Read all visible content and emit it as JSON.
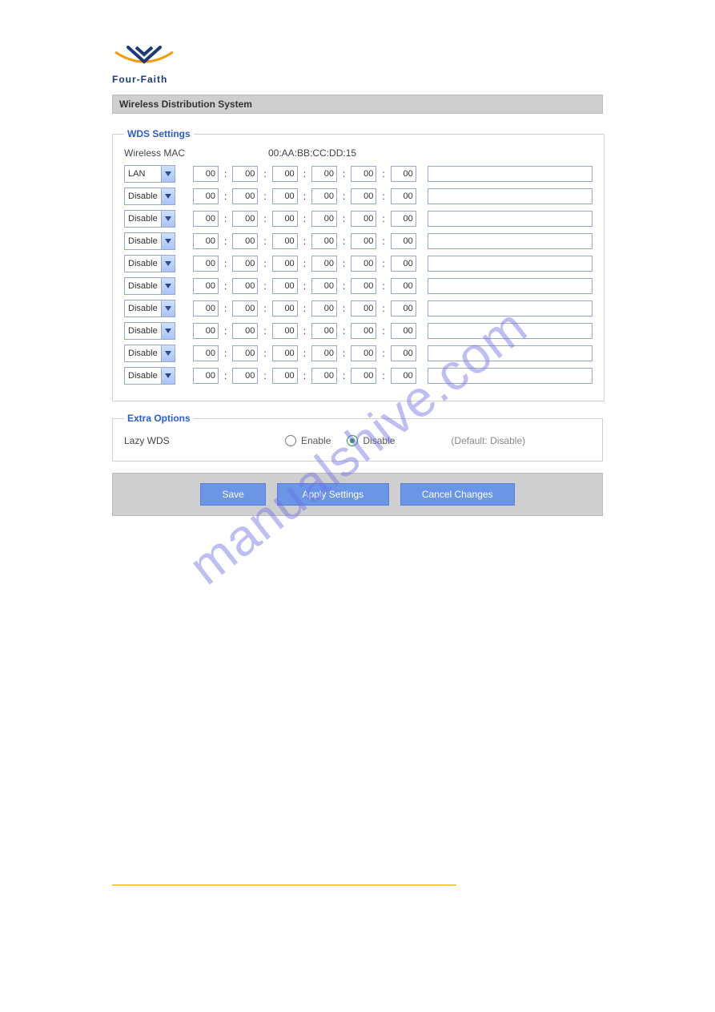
{
  "brand": "Four-Faith",
  "page_title": "Wireless Distribution System",
  "watermark": "manualshive.com",
  "wds": {
    "legend": "WDS Settings",
    "mac_label": "Wireless MAC",
    "mac_value": "00:AA:BB:CC:DD:15",
    "rows": [
      {
        "mode": "LAN",
        "mac": [
          "00",
          "00",
          "00",
          "00",
          "00",
          "00"
        ],
        "note": ""
      },
      {
        "mode": "Disable",
        "mac": [
          "00",
          "00",
          "00",
          "00",
          "00",
          "00"
        ],
        "note": ""
      },
      {
        "mode": "Disable",
        "mac": [
          "00",
          "00",
          "00",
          "00",
          "00",
          "00"
        ],
        "note": ""
      },
      {
        "mode": "Disable",
        "mac": [
          "00",
          "00",
          "00",
          "00",
          "00",
          "00"
        ],
        "note": ""
      },
      {
        "mode": "Disable",
        "mac": [
          "00",
          "00",
          "00",
          "00",
          "00",
          "00"
        ],
        "note": ""
      },
      {
        "mode": "Disable",
        "mac": [
          "00",
          "00",
          "00",
          "00",
          "00",
          "00"
        ],
        "note": ""
      },
      {
        "mode": "Disable",
        "mac": [
          "00",
          "00",
          "00",
          "00",
          "00",
          "00"
        ],
        "note": ""
      },
      {
        "mode": "Disable",
        "mac": [
          "00",
          "00",
          "00",
          "00",
          "00",
          "00"
        ],
        "note": ""
      },
      {
        "mode": "Disable",
        "mac": [
          "00",
          "00",
          "00",
          "00",
          "00",
          "00"
        ],
        "note": ""
      },
      {
        "mode": "Disable",
        "mac": [
          "00",
          "00",
          "00",
          "00",
          "00",
          "00"
        ],
        "note": ""
      }
    ]
  },
  "extra": {
    "legend": "Extra Options",
    "lazy_label": "Lazy WDS",
    "enable_label": "Enable",
    "disable_label": "Disable",
    "selected": "Disable",
    "default_hint": "(Default: Disable)"
  },
  "buttons": {
    "save": "Save",
    "apply": "Apply Settings",
    "cancel": "Cancel Changes"
  }
}
